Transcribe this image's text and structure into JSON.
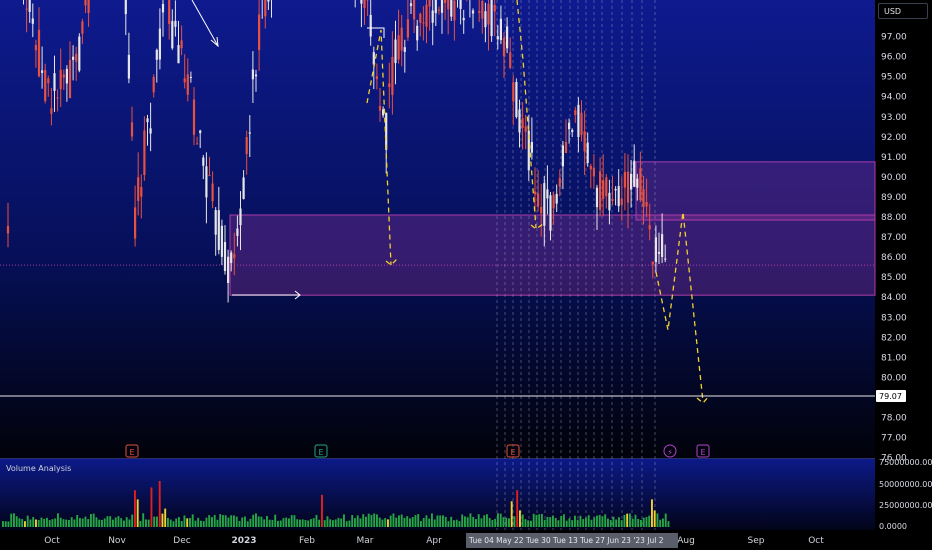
{
  "currency": "USD",
  "last_price_label": "79.07",
  "volume_panel_title": "Volume Analysis",
  "price_axis_labels": [
    "97.00",
    "96.00",
    "95.00",
    "94.00",
    "93.00",
    "92.00",
    "91.00",
    "90.00",
    "89.00",
    "88.00",
    "87.00",
    "86.00",
    "85.00",
    "84.00",
    "83.00",
    "82.00",
    "81.00",
    "80.00",
    "78.00",
    "77.00",
    "76.00"
  ],
  "volume_axis_labels": [
    "75000000.00",
    "50000000.00",
    "25000000.00",
    "0.0000"
  ],
  "time_axis_labels": [
    "Oct",
    "Nov",
    "Dec",
    "2023",
    "Feb",
    "Mar",
    "Apr",
    "Aug",
    "Sep",
    "Oct"
  ],
  "crosshair_date_labels": "Tue 04 May 22  Tue 30  Tue 13  Tue 27 Jun 23  '23 Jul 2",
  "event_markers": [
    "E",
    "E",
    "E",
    "⚡",
    "E"
  ],
  "colors": {
    "up": "#e6e6e6",
    "down": "#e8503f",
    "zone": "#b03ca8",
    "projection": "#f2d02e",
    "vol_green": "#26a646",
    "vol_yellow": "#f2d02e",
    "vol_red": "#e02020"
  }
}
